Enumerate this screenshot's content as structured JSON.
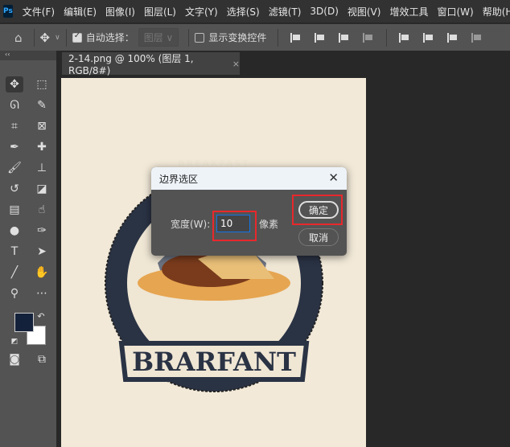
{
  "app": {
    "logo": "Ps"
  },
  "menu": [
    "文件(F)",
    "编辑(E)",
    "图像(I)",
    "图层(L)",
    "文字(Y)",
    "选择(S)",
    "滤镜(T)",
    "3D(D)",
    "视图(V)",
    "增效工具",
    "窗口(W)",
    "帮助(H)"
  ],
  "options": {
    "auto_select_label": "自动选择：",
    "auto_select_checked": true,
    "layer_select": "图层",
    "show_transform_label": "显示变换控件",
    "show_transform_checked": false
  },
  "tab": {
    "title": "2-14.png @ 100% (图层 1, RGB/8#)",
    "close": "×"
  },
  "panel_collapse": "‹‹",
  "artwork": {
    "title": "BRARFANT",
    "arc_text": "BREAKFAST"
  },
  "dialog": {
    "title": "边界选区",
    "close": "✕",
    "width_label": "宽度(W):",
    "width_value": "10",
    "unit": "像素",
    "ok": "确定",
    "cancel": "取消"
  },
  "colors": {
    "foreground": "#14213a",
    "background": "#ffffff",
    "highlight": "#e8282c"
  }
}
